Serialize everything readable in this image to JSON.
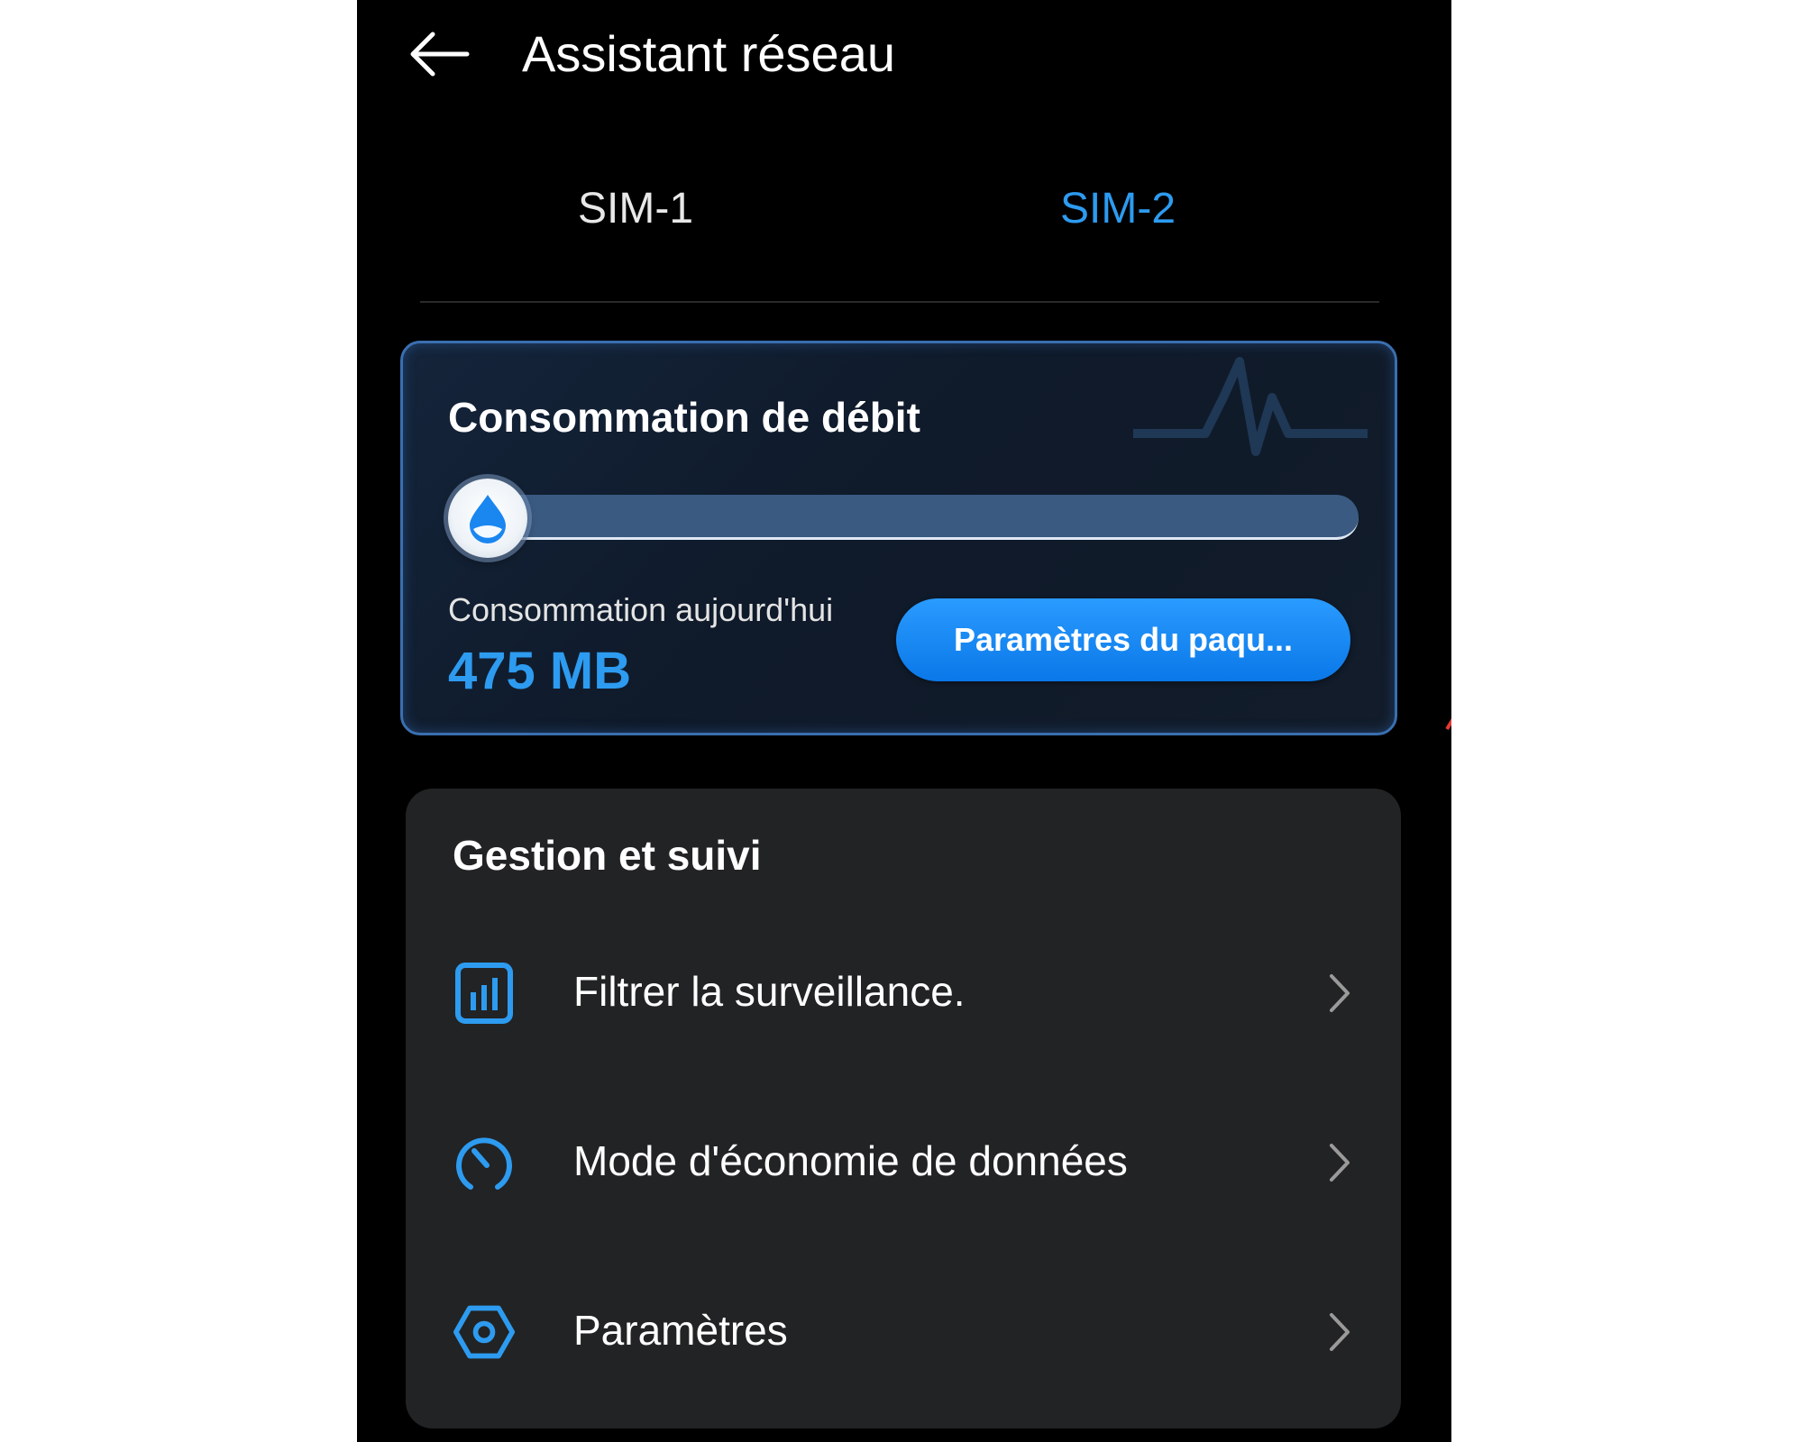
{
  "header": {
    "title": "Assistant réseau",
    "back_icon": "arrow-left-icon"
  },
  "tabs": [
    {
      "label": "SIM-1",
      "active": false
    },
    {
      "label": "SIM-2",
      "active": true
    }
  ],
  "data_card": {
    "title": "Consommation de débit",
    "progress_fraction": 0.0,
    "today_label": "Consommation aujourd'hui",
    "today_value": "475 MB",
    "plan_button_label": "Paramètres du paqu..."
  },
  "management": {
    "title": "Gestion et suivi",
    "items": [
      {
        "label": "Filtrer la surveillance.",
        "icon": "bar-chart-icon"
      },
      {
        "label": "Mode d'économie de données",
        "icon": "speedometer-icon"
      },
      {
        "label": "Paramètres",
        "icon": "hexagon-settings-icon"
      }
    ]
  },
  "colors": {
    "accent": "#2d9bf0",
    "background": "#000000",
    "card": "#222324",
    "annotation": "#e53935"
  }
}
